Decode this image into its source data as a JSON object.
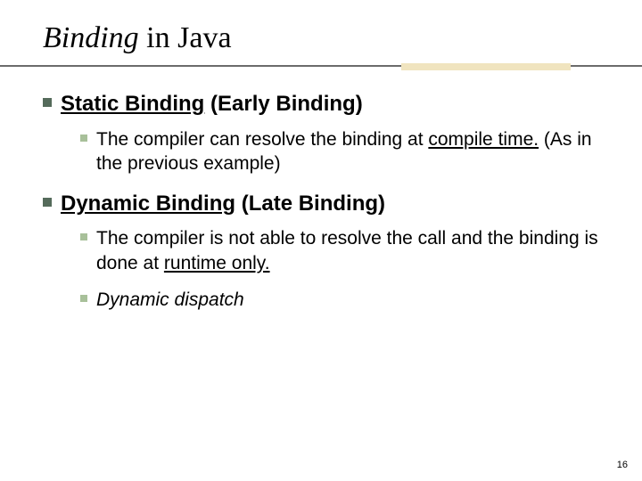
{
  "title": {
    "italic": "Binding",
    "rest": " in Java"
  },
  "sections": [
    {
      "heading_underlined": "Static Binding",
      "heading_rest": " (Early Binding)",
      "items": [
        {
          "pre": "The compiler can resolve the binding at ",
          "underlined": "compile time.",
          "post": "  (As in the previous example)",
          "italic": false
        }
      ]
    },
    {
      "heading_underlined": "Dynamic Binding",
      "heading_rest": " (Late Binding)",
      "items": [
        {
          "pre": "The compiler is not able to resolve the call and the binding is done at ",
          "underlined": "runtime only.",
          "post": "",
          "italic": false
        },
        {
          "pre": "Dynamic dispatch",
          "underlined": "",
          "post": "",
          "italic": true
        }
      ]
    }
  ],
  "page_number": "16"
}
